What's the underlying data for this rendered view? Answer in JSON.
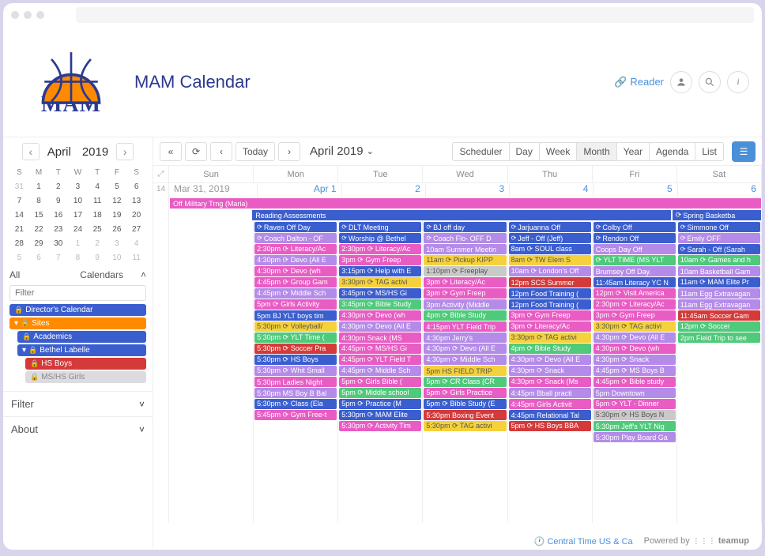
{
  "brand": {
    "name": "MAM",
    "title": "MAM Calendar"
  },
  "header": {
    "reader": "Reader"
  },
  "mini": {
    "month": "April",
    "year": "2019",
    "dow": [
      "S",
      "M",
      "T",
      "W",
      "T",
      "F",
      "S"
    ],
    "weeks": [
      [
        {
          "d": "31",
          "m": true
        },
        {
          "d": "1"
        },
        {
          "d": "2"
        },
        {
          "d": "3"
        },
        {
          "d": "4"
        },
        {
          "d": "5"
        },
        {
          "d": "6"
        }
      ],
      [
        {
          "d": "7"
        },
        {
          "d": "8"
        },
        {
          "d": "9"
        },
        {
          "d": "10"
        },
        {
          "d": "11"
        },
        {
          "d": "12"
        },
        {
          "d": "13"
        }
      ],
      [
        {
          "d": "14"
        },
        {
          "d": "15"
        },
        {
          "d": "16"
        },
        {
          "d": "17"
        },
        {
          "d": "18"
        },
        {
          "d": "19"
        },
        {
          "d": "20"
        }
      ],
      [
        {
          "d": "21"
        },
        {
          "d": "22"
        },
        {
          "d": "23"
        },
        {
          "d": "24"
        },
        {
          "d": "25"
        },
        {
          "d": "26"
        },
        {
          "d": "27"
        }
      ],
      [
        {
          "d": "28"
        },
        {
          "d": "29"
        },
        {
          "d": "30"
        },
        {
          "d": "1",
          "m": true
        },
        {
          "d": "2",
          "m": true
        },
        {
          "d": "3",
          "m": true
        },
        {
          "d": "4",
          "m": true
        }
      ],
      [
        {
          "d": "5",
          "m": true
        },
        {
          "d": "6",
          "m": true
        },
        {
          "d": "7",
          "m": true
        },
        {
          "d": "8",
          "m": true
        },
        {
          "d": "9",
          "m": true
        },
        {
          "d": "10",
          "m": true
        },
        {
          "d": "11",
          "m": true
        }
      ]
    ]
  },
  "sidebar": {
    "all": "All",
    "calendars": "Calendars",
    "filter_placeholder": "Filter",
    "items": [
      {
        "label": "Director's Calendar",
        "color": "#3b5ecf",
        "indent": 0,
        "lock": true
      },
      {
        "label": "Sites",
        "color": "#ff8a00",
        "indent": 0,
        "lock": true,
        "expand": true
      },
      {
        "label": "Academics",
        "color": "#3b5ecf",
        "indent": 1,
        "lock": true
      },
      {
        "label": "Bethel Labelle",
        "color": "#3b5ecf",
        "indent": 1,
        "lock": true,
        "expand": true
      },
      {
        "label": "HS Boys",
        "color": "#d43a3a",
        "indent": 2,
        "lock": true
      },
      {
        "label": "MS/HS Girls",
        "color": "#dcdce0",
        "indent": 2,
        "lock": true,
        "fg": "#888"
      }
    ],
    "filter_section": "Filter",
    "about_section": "About"
  },
  "toolbar": {
    "today": "Today",
    "range": "April 2019",
    "views": [
      "Scheduler",
      "Day",
      "Week",
      "Month",
      "Year",
      "Agenda",
      "List"
    ],
    "active": "Month"
  },
  "grid": {
    "dow": [
      "Sun",
      "Mon",
      "Tue",
      "Wed",
      "Thu",
      "Fri",
      "Sat"
    ],
    "week_num": "14",
    "date_first": "Mar 31, 2019",
    "dates": [
      "Apr 1",
      "2",
      "3",
      "4",
      "5",
      "6"
    ],
    "span_events": [
      {
        "label": "Off Military Trng (Maria)",
        "color": "#e85cc3",
        "start": 0,
        "end": 6
      },
      {
        "label": "Reading Assessments",
        "color": "#3b5ecf",
        "start": 1,
        "end": 5
      },
      {
        "label": "Spring Basketba",
        "color": "#3b5ecf",
        "start": 6,
        "end": 6,
        "icon": true
      }
    ],
    "cols": [
      [],
      [
        {
          "t": "Raven Off Day",
          "c": "#3b5ecf",
          "i": true
        },
        {
          "t": "Coach Dalton - OF",
          "c": "#b48be8",
          "i": true
        },
        {
          "t": "2:30pm ⟳ Literacy/Ac",
          "c": "#e85cc3"
        },
        {
          "t": "4:30pm ⟳ Devo (All E",
          "c": "#b48be8"
        },
        {
          "t": "4:30pm ⟳ Devo (wh",
          "c": "#e85cc3"
        },
        {
          "t": "4:45pm ⟳ Group Gam",
          "c": "#e85cc3"
        },
        {
          "t": "4:45pm ⟳ Middle Sch",
          "c": "#b48be8"
        },
        {
          "t": "5pm ⟳ Girls Activity",
          "c": "#e85cc3"
        },
        {
          "t": "5pm BJ YLT boys tim",
          "c": "#3b5ecf"
        },
        {
          "t": "5:30pm ⟳ Volleyball/",
          "c": "#f5d13b",
          "fg": "#555"
        },
        {
          "t": "5:30pm ⟳ YLT Time (",
          "c": "#4fc97a"
        },
        {
          "t": "5:30pm ⟳ Soccer Pra",
          "c": "#d43a3a"
        },
        {
          "t": "5:30pm ⟳ HS Boys",
          "c": "#3b5ecf"
        },
        {
          "t": "5:30pm ⟳ Whit Small",
          "c": "#b48be8"
        },
        {
          "t": "5:30pm Ladies Night",
          "c": "#e85cc3"
        },
        {
          "t": "5:30pm MS Boy B Bal",
          "c": "#b48be8"
        },
        {
          "t": "5:30pm ⟳ Class (Ela",
          "c": "#3b5ecf"
        },
        {
          "t": "5:45pm ⟳ Gym Free-t",
          "c": "#e85cc3"
        }
      ],
      [
        {
          "t": "DLT Meeting",
          "c": "#3b5ecf",
          "i": true
        },
        {
          "t": "Worship @ Bethel",
          "c": "#3b5ecf",
          "i": true
        },
        {
          "t": "2:30pm ⟳ Literacy/Ac",
          "c": "#e85cc3"
        },
        {
          "t": "3pm ⟳ Gym Freep",
          "c": "#e85cc3"
        },
        {
          "t": "3:15pm ⟳ Help with E",
          "c": "#3b5ecf"
        },
        {
          "t": "3:30pm ⟳ TAG activi",
          "c": "#f5d13b",
          "fg": "#555"
        },
        {
          "t": "3:45pm ⟳ MS/HS Gi",
          "c": "#3b5ecf"
        },
        {
          "t": "3:45pm ⟳ Bible Study",
          "c": "#4fc97a"
        },
        {
          "t": "4:30pm ⟳ Devo (wh",
          "c": "#e85cc3"
        },
        {
          "t": "4:30pm ⟳ Devo (All E",
          "c": "#b48be8"
        },
        {
          "t": "4:30pm Snack (MS",
          "c": "#e85cc3"
        },
        {
          "t": "4:45pm ⟳ MS/HS Gi",
          "c": "#e85cc3"
        },
        {
          "t": "4:45pm ⟳ YLT Field T",
          "c": "#e85cc3"
        },
        {
          "t": "4:45pm ⟳ Middle Sch",
          "c": "#b48be8"
        },
        {
          "t": "5pm ⟳ Girls Bible (",
          "c": "#e85cc3"
        },
        {
          "t": "5pm ⟳ Middle school",
          "c": "#4fc97a"
        },
        {
          "t": "5pm ⟳ Practice (M",
          "c": "#3b5ecf"
        },
        {
          "t": "5:30pm ⟳ MAM Elite",
          "c": "#3b5ecf"
        },
        {
          "t": "5:30pm ⟳ Activity Tim",
          "c": "#e85cc3"
        }
      ],
      [
        {
          "t": "BJ off day",
          "c": "#3b5ecf",
          "i": true
        },
        {
          "t": "Coach Flo- OFF D",
          "c": "#b48be8",
          "i": true
        },
        {
          "t": "10am Summer Meetin",
          "c": "#b48be8"
        },
        {
          "t": "11am ⟳ Pickup KIPP",
          "c": "#f5d13b",
          "fg": "#555"
        },
        {
          "t": "1:10pm ⟳ Freeplay",
          "c": "#c9c9c9",
          "fg": "#555"
        },
        {
          "t": "3pm ⟳ Literacy/Ac",
          "c": "#e85cc3"
        },
        {
          "t": "3pm ⟳ Gym Freep",
          "c": "#e85cc3"
        },
        {
          "t": "3pm Activity (Middle",
          "c": "#b48be8"
        },
        {
          "t": "4pm ⟳ Bible Study",
          "c": "#4fc97a"
        },
        {
          "t": "4:15pm YLT Field Trip",
          "c": "#e85cc3"
        },
        {
          "t": "4:30pm Jerry's",
          "c": "#b48be8"
        },
        {
          "t": "4:30pm ⟳ Devo (All E",
          "c": "#b48be8"
        },
        {
          "t": "4:30pm ⟳ Middle Sch",
          "c": "#b48be8"
        },
        {
          "t": "5pm HS FIELD TRIP",
          "c": "#f5d13b",
          "fg": "#555"
        },
        {
          "t": "5pm ⟳ CR Class (CR",
          "c": "#4fc97a"
        },
        {
          "t": "5pm ⟳ Girls Practice",
          "c": "#e85cc3"
        },
        {
          "t": "5pm ⟳ Bible Study (E",
          "c": "#3b5ecf"
        },
        {
          "t": "5:30pm Boxing Event",
          "c": "#d43a3a"
        },
        {
          "t": "5:30pm ⟳ TAG activi",
          "c": "#f5d13b",
          "fg": "#555"
        }
      ],
      [
        {
          "t": "Jarjuanna Off",
          "c": "#3b5ecf",
          "i": true
        },
        {
          "t": "Jeff - Off (Jeff)",
          "c": "#3b5ecf",
          "i": true
        },
        {
          "t": "8am ⟳ SOUL class",
          "c": "#3b5ecf"
        },
        {
          "t": "8am ⟳ TW Elem S",
          "c": "#f5d13b",
          "fg": "#555"
        },
        {
          "t": "10am ⟳ London's Off",
          "c": "#b48be8"
        },
        {
          "t": "12pm SCS Summer",
          "c": "#d43a3a"
        },
        {
          "t": "12pm Food Training (",
          "c": "#3b5ecf"
        },
        {
          "t": "12pm Food Training (",
          "c": "#3b5ecf"
        },
        {
          "t": "3pm ⟳ Gym Freep",
          "c": "#e85cc3"
        },
        {
          "t": "3pm ⟳ Literacy/Ac",
          "c": "#e85cc3"
        },
        {
          "t": "3:30pm ⟳ TAG activi",
          "c": "#f5d13b",
          "fg": "#555"
        },
        {
          "t": "4pm ⟳ Bible Study",
          "c": "#4fc97a"
        },
        {
          "t": "4:30pm ⟳ Devo (All E",
          "c": "#b48be8"
        },
        {
          "t": "4:30pm ⟳ Snack",
          "c": "#b48be8"
        },
        {
          "t": "4:30pm ⟳ Snack (Ms",
          "c": "#e85cc3"
        },
        {
          "t": "4:45pm Bball practi",
          "c": "#b48be8"
        },
        {
          "t": "4:45pm Girls Activit",
          "c": "#e85cc3"
        },
        {
          "t": "4:45pm Relational Tal",
          "c": "#3b5ecf"
        },
        {
          "t": "5pm ⟳ HS Boys BBA",
          "c": "#d43a3a"
        }
      ],
      [
        {
          "t": "Colby Off",
          "c": "#3b5ecf",
          "i": true
        },
        {
          "t": "Rendon Off",
          "c": "#3b5ecf",
          "i": true
        },
        {
          "t": "Coops Day Off",
          "c": "#b48be8"
        },
        {
          "t": "⟳ YLT TIME (MS YLT",
          "c": "#4fc97a"
        },
        {
          "t": "Brumsey Off Day.",
          "c": "#b48be8"
        },
        {
          "t": "11:45am Literacy YC N",
          "c": "#3b5ecf"
        },
        {
          "t": "12pm ⟳ Visit America",
          "c": "#e85cc3"
        },
        {
          "t": "2:30pm ⟳ Literacy/Ac",
          "c": "#e85cc3"
        },
        {
          "t": "3pm ⟳ Gym Freep",
          "c": "#e85cc3"
        },
        {
          "t": "3:30pm ⟳ TAG activi",
          "c": "#f5d13b",
          "fg": "#555"
        },
        {
          "t": "4:30pm ⟳ Devo (All E",
          "c": "#b48be8"
        },
        {
          "t": "4:30pm ⟳ Devo (wh",
          "c": "#e85cc3"
        },
        {
          "t": "4:30pm ⟳ Snack",
          "c": "#b48be8"
        },
        {
          "t": "4:45pm ⟳ MS Boys B",
          "c": "#b48be8"
        },
        {
          "t": "4:45pm ⟳ Bible study",
          "c": "#e85cc3"
        },
        {
          "t": "5pm Downtown",
          "c": "#b48be8"
        },
        {
          "t": "5pm ⟳ YLT - Dinner",
          "c": "#e85cc3"
        },
        {
          "t": "5:30pm ⟳ HS Boys N",
          "c": "#c9c9c9",
          "fg": "#555"
        },
        {
          "t": "5:30pm Jeff's YLT Nig",
          "c": "#4fc97a"
        },
        {
          "t": "5:30pm Play Board Ga",
          "c": "#b48be8"
        }
      ],
      [
        {
          "t": "Simmone Off",
          "c": "#3b5ecf",
          "i": true
        },
        {
          "t": "Emily OFF",
          "c": "#b48be8",
          "i": true
        },
        {
          "t": "Sarah - Off (Sarah",
          "c": "#3b5ecf",
          "i": true
        },
        {
          "t": "10am ⟳ Games and h",
          "c": "#4fc97a"
        },
        {
          "t": "10am Basketball Gam",
          "c": "#b48be8"
        },
        {
          "t": "11am ⟳ MAM Elite Pr",
          "c": "#3b5ecf"
        },
        {
          "t": "11am Egg Extravagan",
          "c": "#b48be8"
        },
        {
          "t": "11am Egg Extravagan",
          "c": "#b48be8"
        },
        {
          "t": "11:45am Soccer Gam",
          "c": "#d43a3a"
        },
        {
          "t": "12pm ⟳ Soccer",
          "c": "#4fc97a"
        },
        {
          "t": "2pm Field Trip to see",
          "c": "#4fc97a"
        }
      ]
    ]
  },
  "footer": {
    "tz": "Central Time US & Ca",
    "powered": "Powered by",
    "brand": "teamup"
  }
}
